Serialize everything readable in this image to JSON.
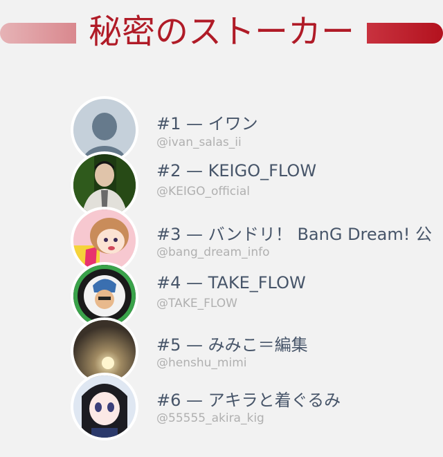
{
  "header": {
    "title": "秘密のストーカー"
  },
  "users": [
    {
      "rank_name": "#1 — イワン",
      "handle": "@ivan_salas_ii"
    },
    {
      "rank_name": "#2 — KEIGO_FLOW",
      "handle": "@KEIGO_official"
    },
    {
      "rank_name": "#3 — バンドリ！ BanG Dream! 公",
      "handle": "@bang_dream_info"
    },
    {
      "rank_name": "#4 — TAKE_FLOW",
      "handle": "@TAKE_FLOW"
    },
    {
      "rank_name": "#5 — みみこ＝編集",
      "handle": "@henshu_mimi"
    },
    {
      "rank_name": "#6 — アキラと着ぐるみ",
      "handle": "@55555_akira_kig"
    }
  ],
  "colors": {
    "title": "#b01b27",
    "name_text": "#475569",
    "handle_text": "#b0b0b0",
    "background": "#f2f2f2"
  }
}
